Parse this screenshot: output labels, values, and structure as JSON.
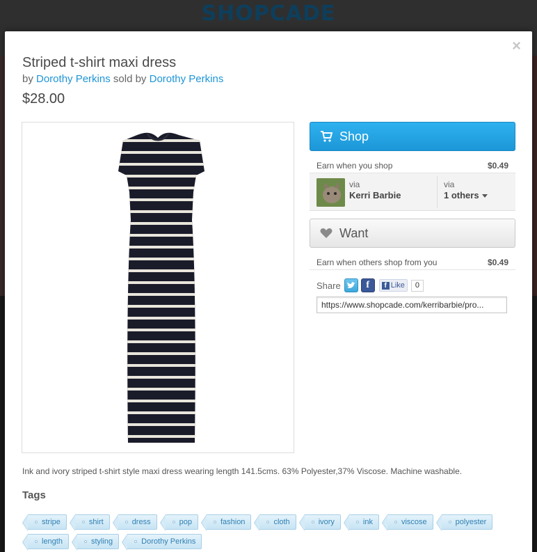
{
  "site": {
    "logo": "SHOPCADE"
  },
  "modal": {
    "close_label": "×"
  },
  "product": {
    "title": "Striped t-shirt maxi dress",
    "by_prefix": "by",
    "brand": "Dorothy Perkins",
    "sold_by_prefix": "sold by",
    "seller": "Dorothy Perkins",
    "price": "$28.00",
    "description": "Ink and ivory striped t-shirt style maxi dress wearing length 141.5cms. 63% Polyester,37% Viscose. Machine washable.",
    "image_icon": "striped-dress-photo"
  },
  "actions": {
    "shop_label": "Shop",
    "shop_icon": "cart-icon",
    "earn_shop_label": "Earn when you shop",
    "earn_shop_value": "$0.49",
    "via_label": "via",
    "via_user": "Kerri Barbie",
    "via2_label": "via",
    "via_others": "1 others",
    "want_label": "Want",
    "want_icon": "heart-icon",
    "earn_others_label": "Earn when others shop from you",
    "earn_others_value": "$0.49"
  },
  "share": {
    "label": "Share",
    "like_label": "Like",
    "like_count": "0",
    "url": "https://www.shopcade.com/kerribarbie/pro..."
  },
  "tags": {
    "heading": "Tags",
    "items": [
      "stripe",
      "shirt",
      "dress",
      "pop",
      "fashion",
      "cloth",
      "ivory",
      "ink",
      "viscose",
      "polyester",
      "length",
      "styling",
      "Dorothy Perkins"
    ]
  },
  "colors": {
    "accent": "#1f95d6",
    "shop_button": "#2fb1ef",
    "tag_text": "#2f7fb3"
  }
}
